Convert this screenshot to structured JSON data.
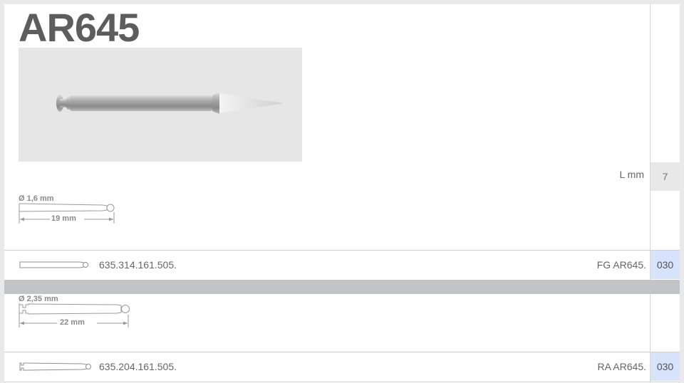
{
  "title": "AR645",
  "spec": {
    "length_label": "L mm",
    "length_value": "7"
  },
  "shank1": {
    "diameter_label": "Ø 1,6 mm",
    "length_label": "19 mm"
  },
  "row1": {
    "article_number": "635.314.161.505.",
    "designation": "FG AR645.",
    "code": "030"
  },
  "shank2": {
    "diameter_label": "Ø 2,35 mm",
    "length_label": "22 mm"
  },
  "row2": {
    "article_number": "635.204.161.505.",
    "designation": "RA AR645.",
    "code": "030"
  }
}
